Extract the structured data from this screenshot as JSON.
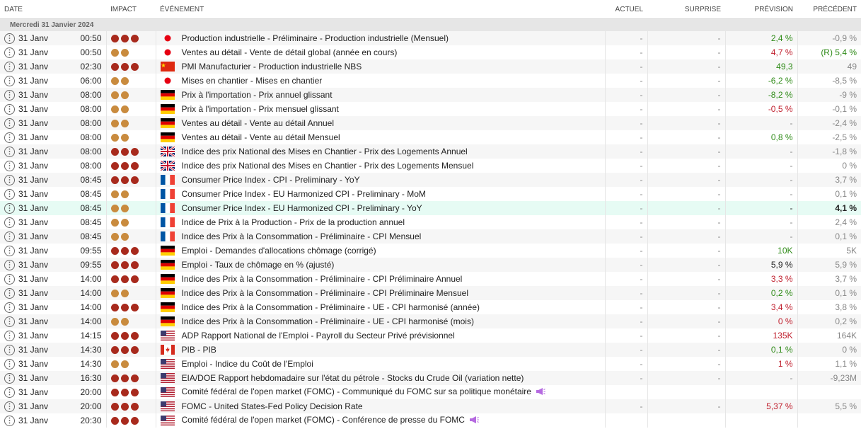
{
  "headers": {
    "date": "DATE",
    "impact": "IMPACT",
    "event": "ÉVÉNEMENT",
    "actual": "ACTUEL",
    "surprise": "SURPRISE",
    "forecast": "PRÉVISION",
    "previous": "PRÉCÉDENT"
  },
  "day_label": "Mercredi 31 Janvier 2024",
  "colors": {
    "high": "#a82a1d",
    "medium": "#c98b3e",
    "green": "#2f8b18",
    "red": "#c0202e"
  },
  "rows": [
    {
      "date": "31 Janv",
      "time": "00:50",
      "impact": 3,
      "country": "JP",
      "event": "Production industrielle - Préliminaire - Production industrielle (Mensuel)",
      "actual": "-",
      "surprise": "-",
      "forecast": "2,4 %",
      "forecast_color": "green",
      "previous": "-0,9 %",
      "previous_style": "grey"
    },
    {
      "date": "31 Janv",
      "time": "00:50",
      "impact": 2,
      "country": "JP",
      "event": "Ventes au détail - Vente de détail global (année en cours)",
      "actual": "-",
      "surprise": "-",
      "forecast": "4,7 %",
      "forecast_color": "red",
      "previous": "(R) 5,4 %",
      "previous_style": "green"
    },
    {
      "date": "31 Janv",
      "time": "02:30",
      "impact": 3,
      "country": "CN",
      "event": "PMI Manufacturier - Production industrielle NBS",
      "actual": "-",
      "surprise": "-",
      "forecast": "49,3",
      "forecast_color": "green",
      "previous": "49",
      "previous_style": "grey"
    },
    {
      "date": "31 Janv",
      "time": "06:00",
      "impact": 2,
      "country": "JP",
      "event": "Mises en chantier - Mises en chantier",
      "actual": "-",
      "surprise": "-",
      "forecast": "-6,2 %",
      "forecast_color": "green",
      "previous": "-8,5 %",
      "previous_style": "grey"
    },
    {
      "date": "31 Janv",
      "time": "08:00",
      "impact": 2,
      "country": "DE",
      "event": "Prix à l'importation - Prix annuel glissant",
      "actual": "-",
      "surprise": "-",
      "forecast": "-8,2 %",
      "forecast_color": "green",
      "previous": "-9 %",
      "previous_style": "grey"
    },
    {
      "date": "31 Janv",
      "time": "08:00",
      "impact": 2,
      "country": "DE",
      "event": "Prix à l'importation - Prix mensuel glissant",
      "actual": "-",
      "surprise": "-",
      "forecast": "-0,5 %",
      "forecast_color": "red",
      "previous": "-0,1 %",
      "previous_style": "grey"
    },
    {
      "date": "31 Janv",
      "time": "08:00",
      "impact": 2,
      "country": "DE",
      "event": "Ventes au détail - Vente au détail Annuel",
      "actual": "-",
      "surprise": "-",
      "forecast": "-",
      "forecast_color": "grey",
      "previous": "-2,4 %",
      "previous_style": "grey"
    },
    {
      "date": "31 Janv",
      "time": "08:00",
      "impact": 2,
      "country": "DE",
      "event": "Ventes au détail - Vente au détail Mensuel",
      "actual": "-",
      "surprise": "-",
      "forecast": "0,8 %",
      "forecast_color": "green",
      "previous": "-2,5 %",
      "previous_style": "grey"
    },
    {
      "date": "31 Janv",
      "time": "08:00",
      "impact": 3,
      "country": "GB",
      "event": "Indice des prix National des Mises en Chantier - Prix des Logements Annuel",
      "actual": "-",
      "surprise": "-",
      "forecast": "-",
      "forecast_color": "grey",
      "previous": "-1,8 %",
      "previous_style": "grey"
    },
    {
      "date": "31 Janv",
      "time": "08:00",
      "impact": 3,
      "country": "GB",
      "event": "Indice des prix National des Mises en Chantier - Prix des Logements Mensuel",
      "actual": "-",
      "surprise": "-",
      "forecast": "-",
      "forecast_color": "grey",
      "previous": "0 %",
      "previous_style": "grey"
    },
    {
      "date": "31 Janv",
      "time": "08:45",
      "impact": 3,
      "country": "FR",
      "event": "Consumer Price Index - CPI - Preliminary - YoY",
      "actual": "-",
      "surprise": "-",
      "forecast": "-",
      "forecast_color": "grey",
      "previous": "3,7 %",
      "previous_style": "grey"
    },
    {
      "date": "31 Janv",
      "time": "08:45",
      "impact": 2,
      "country": "FR",
      "event": "Consumer Price Index - EU Harmonized CPI - Preliminary - MoM",
      "actual": "-",
      "surprise": "-",
      "forecast": "-",
      "forecast_color": "grey",
      "previous": "0,1 %",
      "previous_style": "grey"
    },
    {
      "date": "31 Janv",
      "time": "08:45",
      "impact": 2,
      "country": "FR",
      "event": "Consumer Price Index - EU Harmonized CPI - Preliminary - YoY",
      "actual": "-",
      "surprise": "-",
      "forecast": "-",
      "forecast_color": "dark",
      "previous": "4,1 %",
      "previous_style": "bold",
      "highlight": true
    },
    {
      "date": "31 Janv",
      "time": "08:45",
      "impact": 2,
      "country": "FR",
      "event": "Indice de Prix à la Production - Prix de la production annuel",
      "actual": "-",
      "surprise": "-",
      "forecast": "-",
      "forecast_color": "grey",
      "previous": "2,4 %",
      "previous_style": "grey"
    },
    {
      "date": "31 Janv",
      "time": "08:45",
      "impact": 2,
      "country": "FR",
      "event": "Indice des Prix à la Consommation - Préliminaire - CPI Mensuel",
      "actual": "-",
      "surprise": "-",
      "forecast": "-",
      "forecast_color": "grey",
      "previous": "0,1 %",
      "previous_style": "grey"
    },
    {
      "date": "31 Janv",
      "time": "09:55",
      "impact": 3,
      "country": "DE",
      "event": "Emploi - Demandes d'allocations chômage (corrigé)",
      "actual": "-",
      "surprise": "-",
      "forecast": "10K",
      "forecast_color": "green",
      "previous": "5K",
      "previous_style": "grey"
    },
    {
      "date": "31 Janv",
      "time": "09:55",
      "impact": 3,
      "country": "DE",
      "event": "Emploi - Taux de chômage en % (ajusté)",
      "actual": "-",
      "surprise": "-",
      "forecast": "5,9 %",
      "forecast_color": "dark",
      "previous": "5,9 %",
      "previous_style": "grey"
    },
    {
      "date": "31 Janv",
      "time": "14:00",
      "impact": 3,
      "country": "DE",
      "event": "Indice des Prix à la Consommation - Préliminaire - CPI Préliminaire Annuel",
      "actual": "-",
      "surprise": "-",
      "forecast": "3,3 %",
      "forecast_color": "red",
      "previous": "3,7 %",
      "previous_style": "grey"
    },
    {
      "date": "31 Janv",
      "time": "14:00",
      "impact": 2,
      "country": "DE",
      "event": "Indice des Prix à la Consommation - Préliminaire - CPI Préliminaire Mensuel",
      "actual": "-",
      "surprise": "-",
      "forecast": "0,2 %",
      "forecast_color": "green",
      "previous": "0,1 %",
      "previous_style": "grey"
    },
    {
      "date": "31 Janv",
      "time": "14:00",
      "impact": 3,
      "country": "DE",
      "event": "Indice des Prix à la Consommation - Préliminaire - UE - CPI harmonisé (année)",
      "actual": "-",
      "surprise": "-",
      "forecast": "3,4 %",
      "forecast_color": "red",
      "previous": "3,8 %",
      "previous_style": "grey"
    },
    {
      "date": "31 Janv",
      "time": "14:00",
      "impact": 2,
      "country": "DE",
      "event": "Indice des Prix à la Consommation - Préliminaire - UE - CPI harmonisé (mois)",
      "actual": "-",
      "surprise": "-",
      "forecast": "0 %",
      "forecast_color": "red",
      "previous": "0,2 %",
      "previous_style": "grey"
    },
    {
      "date": "31 Janv",
      "time": "14:15",
      "impact": 3,
      "country": "US",
      "event": "ADP Rapport National de l'Emploi - Payroll du Secteur Privé prévisionnel",
      "actual": "-",
      "surprise": "-",
      "forecast": "135K",
      "forecast_color": "red",
      "previous": "164K",
      "previous_style": "grey"
    },
    {
      "date": "31 Janv",
      "time": "14:30",
      "impact": 3,
      "country": "CA",
      "event": "PIB - PIB",
      "actual": "-",
      "surprise": "-",
      "forecast": "0,1 %",
      "forecast_color": "green",
      "previous": "0 %",
      "previous_style": "grey"
    },
    {
      "date": "31 Janv",
      "time": "14:30",
      "impact": 2,
      "country": "US",
      "event": "Emploi - Indice du Coût de l'Emploi",
      "actual": "-",
      "surprise": "-",
      "forecast": "1 %",
      "forecast_color": "red",
      "previous": "1,1 %",
      "previous_style": "grey"
    },
    {
      "date": "31 Janv",
      "time": "16:30",
      "impact": 3,
      "country": "US",
      "event": "EIA/DOE Rapport hebdomadaire sur l'état du pétrole - Stocks du Crude Oil (variation nette)",
      "actual": "-",
      "surprise": "-",
      "forecast": "-",
      "forecast_color": "grey",
      "previous": "-9,23M",
      "previous_style": "grey"
    },
    {
      "date": "31 Janv",
      "time": "20:00",
      "impact": 3,
      "country": "US",
      "event": "Comité fédéral de l'open market (FOMC) - Communiqué du FOMC sur sa politique monétaire",
      "actual": "",
      "surprise": "",
      "forecast": "",
      "forecast_color": "grey",
      "previous": "",
      "previous_style": "grey",
      "megaphone": true
    },
    {
      "date": "31 Janv",
      "time": "20:00",
      "impact": 3,
      "country": "US",
      "event": "FOMC - United States-Fed Policy Decision Rate",
      "actual": "-",
      "surprise": "-",
      "forecast": "5,37 %",
      "forecast_color": "red",
      "previous": "5,5 %",
      "previous_style": "grey"
    },
    {
      "date": "31 Janv",
      "time": "20:30",
      "impact": 3,
      "country": "US",
      "event": "Comité fédéral de l'open market (FOMC) - Conférence de presse du FOMC",
      "actual": "",
      "surprise": "",
      "forecast": "",
      "forecast_color": "grey",
      "previous": "",
      "previous_style": "grey",
      "megaphone": true
    }
  ]
}
